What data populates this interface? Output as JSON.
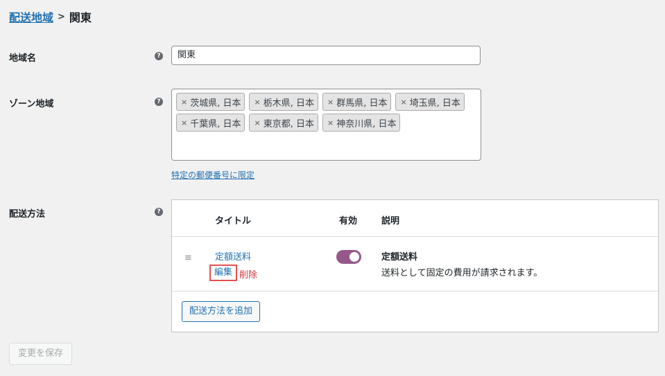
{
  "breadcrumb": {
    "parent": "配送地域",
    "separator": ">",
    "current": "関東"
  },
  "help_icon": "?",
  "zone_name": {
    "label": "地域名",
    "value": "関東"
  },
  "zone_regions": {
    "label": "ゾーン地域",
    "chips": [
      "茨城県, 日本",
      "栃木県, 日本",
      "群馬県, 日本",
      "埼玉県, 日本",
      "千葉県, 日本",
      "東京都, 日本",
      "神奈川県, 日本"
    ],
    "remove_glyph": "×",
    "limit_link": "特定の郵便番号に限定"
  },
  "shipping_methods": {
    "label": "配送方法",
    "columns": {
      "title": "タイトル",
      "enabled": "有効",
      "description": "説明"
    },
    "rows": [
      {
        "title": "定額送料",
        "edit": "編集",
        "delete": "削除",
        "enabled": true,
        "description_title": "定額送料",
        "description": "送料として固定の費用が請求されます。"
      }
    ],
    "add_button": "配送方法を追加"
  },
  "save_button": "変更を保存",
  "colors": {
    "accent": "#2271b1",
    "toggle_on": "#96588a",
    "delete": "#d63638",
    "highlight": "#e55050"
  },
  "icons": {
    "drag": "drag-handle-icon",
    "help": "help-icon",
    "remove": "remove-icon"
  }
}
